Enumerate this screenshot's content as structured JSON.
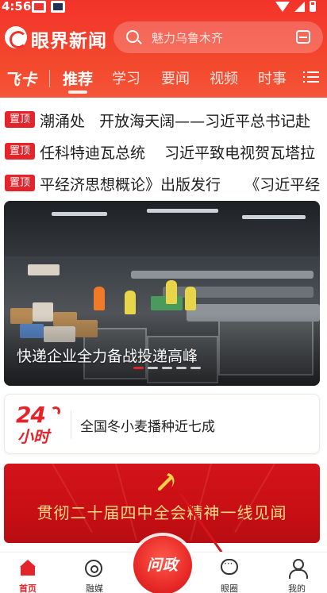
{
  "status_bar": {
    "time": "4:56"
  },
  "header": {
    "logo_text": "眼界新闻",
    "search_placeholder": "魅力乌鲁木齐"
  },
  "tabs": {
    "feika_label": "飞卡",
    "items": [
      "推荐",
      "学习",
      "要闻",
      "视频",
      "时事"
    ],
    "active_index": 0
  },
  "headlines": [
    {
      "badge": "置顶",
      "text": "潮涌处   开放海天阔——习近平总书记赴"
    },
    {
      "badge": "置顶",
      "text": "任科特迪瓦总统    习近平致电视贺瓦塔拉"
    },
    {
      "badge": "置顶",
      "text": "平经济思想概论》出版发行     《习近平经"
    }
  ],
  "banner": {
    "caption": "快递企业全力备战投递高峰",
    "dots_count": 5,
    "active_dot": 0
  },
  "card24": {
    "logo_number": "24",
    "logo_word": "小时",
    "text": "全国冬小麦播种近七成"
  },
  "promo": {
    "text": "贯彻二十届四中全会精神一线见闻"
  },
  "bottom_nav": {
    "items": [
      "首页",
      "融媒",
      "眼圈",
      "我的"
    ],
    "center_label": "问政",
    "active_index": 0
  },
  "colors": {
    "brand_red": "#e4242b",
    "header_red": "#f3332a",
    "promo_gold": "#ffd98a"
  }
}
